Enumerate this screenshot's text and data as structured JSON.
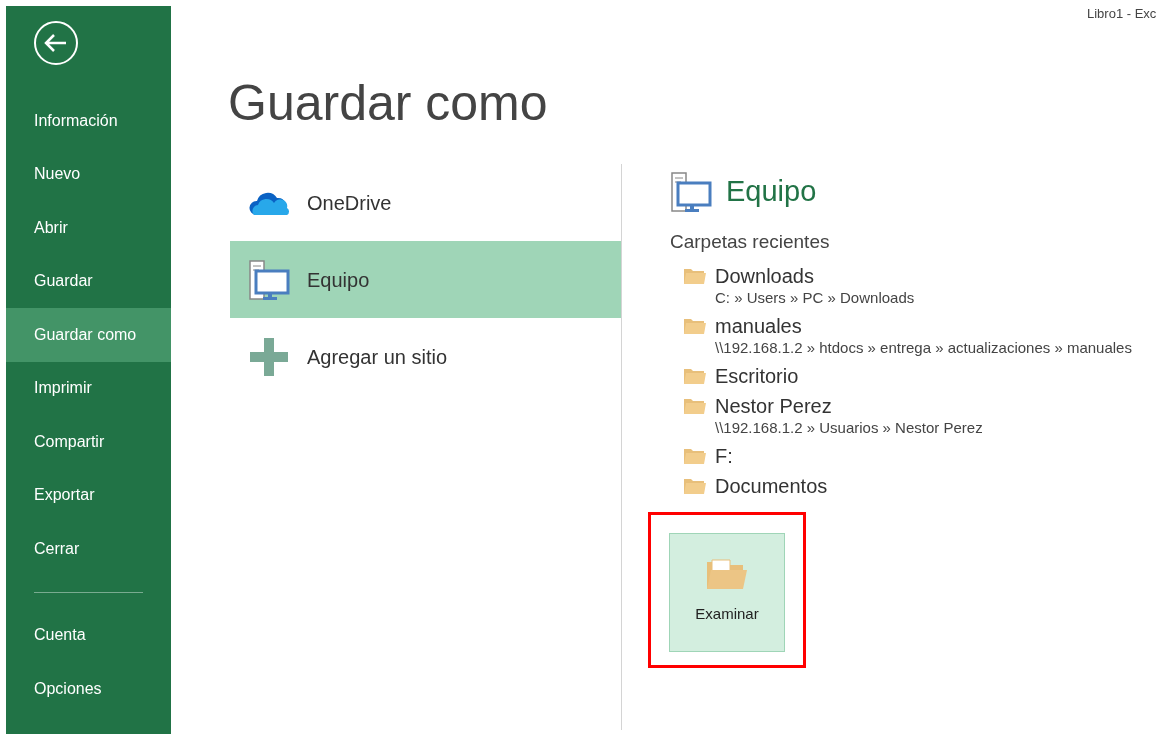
{
  "window": {
    "title": "Libro1 - Exc"
  },
  "sidebar": {
    "items": [
      {
        "label": "Información",
        "selected": false
      },
      {
        "label": "Nuevo",
        "selected": false
      },
      {
        "label": "Abrir",
        "selected": false
      },
      {
        "label": "Guardar",
        "selected": false
      },
      {
        "label": "Guardar como",
        "selected": true
      },
      {
        "label": "Imprimir",
        "selected": false
      },
      {
        "label": "Compartir",
        "selected": false
      },
      {
        "label": "Exportar",
        "selected": false
      },
      {
        "label": "Cerrar",
        "selected": false
      }
    ],
    "footer_items": [
      {
        "label": "Cuenta",
        "selected": false
      },
      {
        "label": "Opciones",
        "selected": false
      }
    ]
  },
  "page_title": "Guardar como",
  "places": [
    {
      "kind": "cloud",
      "label": "OneDrive",
      "selected": false
    },
    {
      "kind": "computer",
      "label": "Equipo",
      "selected": true
    },
    {
      "kind": "add",
      "label": "Agregar un sitio",
      "selected": false
    }
  ],
  "detail": {
    "title": "Equipo",
    "section": "Carpetas recientes",
    "folders": [
      {
        "name": "Downloads",
        "path": "C: » Users » PC » Downloads"
      },
      {
        "name": "manuales",
        "path": "\\\\192.168.1.2 » htdocs » entrega » actualizaciones » manuales"
      },
      {
        "name": "Escritorio"
      },
      {
        "name": "Nestor Perez",
        "path": "\\\\192.168.1.2 » Usuarios » Nestor Perez"
      },
      {
        "name": "F:"
      },
      {
        "name": "Documentos"
      }
    ],
    "browse_button": {
      "label": "Examinar",
      "highlighted": true
    }
  }
}
